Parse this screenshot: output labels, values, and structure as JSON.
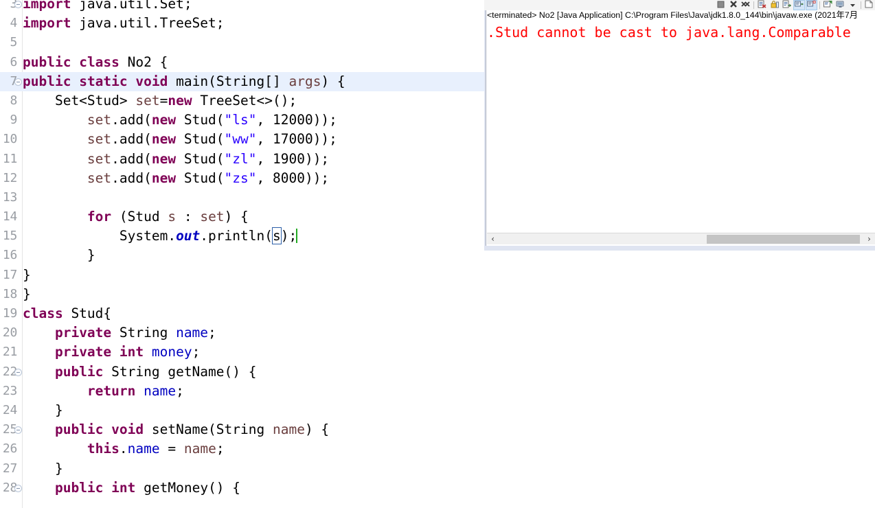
{
  "editor": {
    "name": "java-code-editor",
    "language": "Java",
    "highlighted_line": 7,
    "caret_line": 15,
    "occurrence_highlight_token": "s",
    "colors": {
      "keyword": "#7F0055",
      "string": "#2A00FF",
      "field": "#0000C0",
      "local_variable": "#6A3E3E",
      "static_field": "#0000C0",
      "current_line_highlight": "#E8F0FD",
      "line_number": "#999DA3",
      "caret": "#22AA22"
    },
    "lines": [
      {
        "num": "3",
        "fold": true,
        "text": "import java.util.Set;"
      },
      {
        "num": "4",
        "fold": false,
        "text": "import java.util.TreeSet;"
      },
      {
        "num": "5",
        "fold": false,
        "text": ""
      },
      {
        "num": "6",
        "fold": false,
        "text": "public class No2 {"
      },
      {
        "num": "7",
        "fold": true,
        "text": "public static void main(String[] args) {"
      },
      {
        "num": "8",
        "fold": false,
        "text": "    Set<Stud> set=new TreeSet<>();"
      },
      {
        "num": "9",
        "fold": false,
        "text": "        set.add(new Stud(\"ls\", 12000));"
      },
      {
        "num": "10",
        "fold": false,
        "text": "        set.add(new Stud(\"ww\", 17000));"
      },
      {
        "num": "11",
        "fold": false,
        "text": "        set.add(new Stud(\"zl\", 1900));"
      },
      {
        "num": "12",
        "fold": false,
        "text": "        set.add(new Stud(\"zs\", 8000));"
      },
      {
        "num": "13",
        "fold": false,
        "text": ""
      },
      {
        "num": "14",
        "fold": false,
        "text": "        for (Stud s : set) {"
      },
      {
        "num": "15",
        "fold": false,
        "text": "            System.out.println(s);"
      },
      {
        "num": "16",
        "fold": false,
        "text": "        }"
      },
      {
        "num": "17",
        "fold": false,
        "text": "}"
      },
      {
        "num": "18",
        "fold": false,
        "text": "}"
      },
      {
        "num": "19",
        "fold": false,
        "text": "class Stud{"
      },
      {
        "num": "20",
        "fold": false,
        "text": "    private String name;"
      },
      {
        "num": "21",
        "fold": false,
        "text": "    private int money;"
      },
      {
        "num": "22",
        "fold": true,
        "text": "    public String getName() {"
      },
      {
        "num": "23",
        "fold": false,
        "text": "        return name;"
      },
      {
        "num": "24",
        "fold": false,
        "text": "    }"
      },
      {
        "num": "25",
        "fold": true,
        "text": "    public void setName(String name) {"
      },
      {
        "num": "26",
        "fold": false,
        "text": "        this.name = name;"
      },
      {
        "num": "27",
        "fold": false,
        "text": "    }"
      },
      {
        "num": "28",
        "fold": true,
        "text": "    public int getMoney() {"
      }
    ]
  },
  "console": {
    "name": "console-view",
    "header": "<terminated> No2 [Java Application] C:\\Program Files\\Java\\jdk1.8.0_144\\bin\\javaw.exe (2021年7月",
    "output_lines": [
      ".Stud cannot be cast to java.lang.Comparable"
    ],
    "output_color": "#FF0000",
    "scrollbar": {
      "left_arrow": "‹",
      "right_arrow": "›"
    },
    "toolbar": {
      "buttons": [
        {
          "name": "terminate-button",
          "icon": "stop-square-icon",
          "toggled": false
        },
        {
          "name": "remove-launch-button",
          "icon": "close-x-icon",
          "toggled": false
        },
        {
          "name": "remove-all-launches-button",
          "icon": "close-all-x-icon",
          "toggled": false
        },
        {
          "name": "clear-console-button",
          "icon": "clear-console-icon",
          "toggled": false
        },
        {
          "name": "scroll-lock-button",
          "icon": "lock-icon",
          "toggled": false
        },
        {
          "name": "word-wrap-button",
          "icon": "word-wrap-icon",
          "toggled": false
        },
        {
          "name": "show-console-on-output-button",
          "icon": "console-out-icon",
          "toggled": true
        },
        {
          "name": "show-console-on-error-button",
          "icon": "console-err-icon",
          "toggled": true
        },
        {
          "name": "pin-console-button",
          "icon": "pin-console-icon",
          "toggled": false
        },
        {
          "name": "display-selected-console-button",
          "icon": "display-console-icon",
          "toggled": false
        },
        {
          "name": "console-dropdown-button",
          "icon": "chevron-down-icon",
          "toggled": false
        },
        {
          "name": "open-console-button",
          "icon": "new-console-icon",
          "toggled": false
        }
      ]
    }
  }
}
